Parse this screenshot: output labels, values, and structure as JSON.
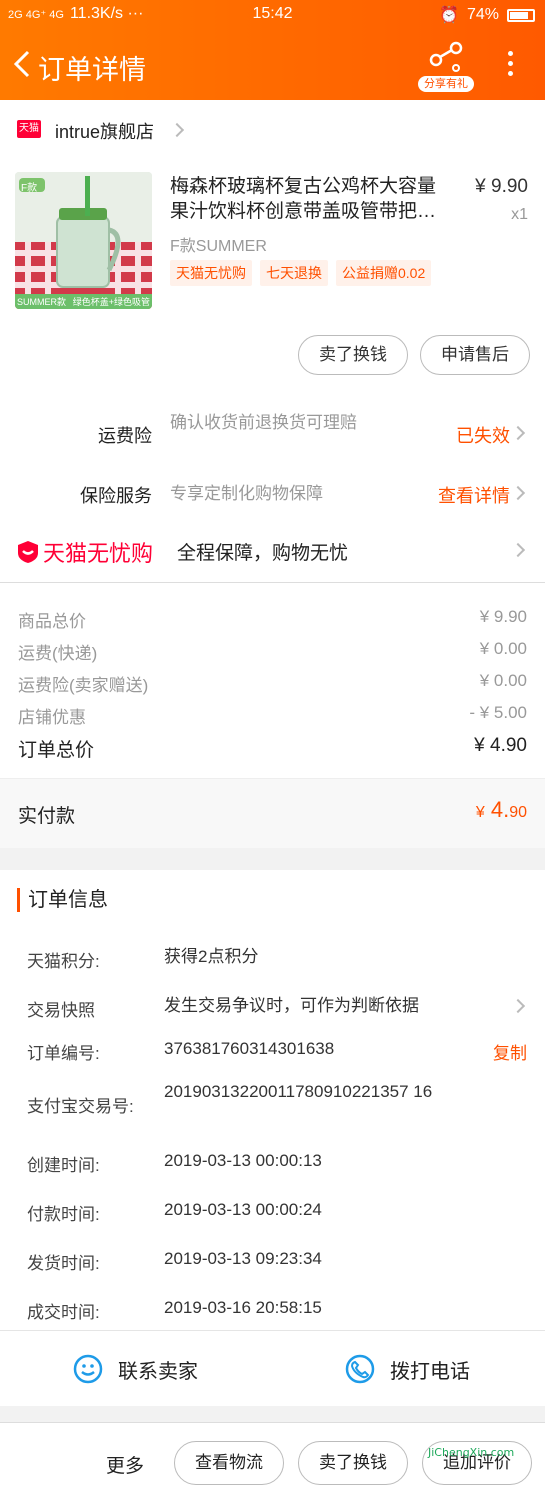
{
  "status": {
    "signal": "2G 4G⁺ 4G",
    "speed": "11.3K/s ···",
    "time": "15:42",
    "battery": "74%"
  },
  "header": {
    "title": "订单详情",
    "share_label": "分享有礼"
  },
  "shop": {
    "badge": "天猫",
    "name": "intrue旗舰店"
  },
  "product": {
    "title": "梅森杯玻璃杯复古公鸡杯大容量果汁饮料杯创意带盖吸管带把…",
    "price": "¥ 9.90",
    "qty": "x1",
    "sku": "F款SUMMER",
    "image_badge": "F款",
    "image_caption_left": "SUMMER款",
    "image_caption_right": "绿色杯盖+绿色吸管",
    "tags": [
      "天猫无忧购",
      "七天退换",
      "公益捐赠0.02"
    ],
    "actions": [
      "卖了换钱",
      "申请售后"
    ]
  },
  "insurance": [
    {
      "label": "运费险",
      "desc": "确认收货前退换货可理赔",
      "link": "已失效"
    },
    {
      "label": "保险服务",
      "desc": "专享定制化购物保障",
      "link": "查看详情"
    }
  ],
  "wuyou": {
    "logo": "天猫无忧购",
    "desc": "全程保障，购物无忧"
  },
  "pricing": [
    {
      "label": "商品总价",
      "value": "¥ 9.90"
    },
    {
      "label": "运费(快递)",
      "value": "¥ 0.00"
    },
    {
      "label": "运费险(卖家赠送)",
      "value": "¥ 0.00"
    },
    {
      "label": "店铺优惠",
      "value": "- ¥ 5.00"
    },
    {
      "label": "订单总价",
      "value": "¥ 4.90"
    }
  ],
  "paid": {
    "label": "实付款",
    "currency": "¥",
    "int": "4.",
    "dec": "90"
  },
  "order_info": {
    "title": "订单信息",
    "rows": [
      {
        "k": "天猫积分:",
        "v": "获得2点积分"
      },
      {
        "k": "交易快照",
        "v": "发生交易争议时，可作为判断依据"
      },
      {
        "k": "订单编号:",
        "v": "376381760314301638",
        "action": "复制"
      },
      {
        "k": "支付宝交易号:",
        "v": "20190313220011780910221357 16"
      },
      {
        "k": "创建时间:",
        "v": "2019-03-13 00:00:13"
      },
      {
        "k": "付款时间:",
        "v": "2019-03-13 00:00:24"
      },
      {
        "k": "发货时间:",
        "v": "2019-03-13 09:23:34"
      },
      {
        "k": "成交时间:",
        "v": "2019-03-16 20:58:15"
      }
    ]
  },
  "contact": {
    "seller": "联系卖家",
    "phone": "拨打电话"
  },
  "bottom": {
    "more": "更多",
    "logistics": "查看物流",
    "resell": "卖了换钱",
    "review": "追加评价"
  },
  "watermark": "JiChengXin.com",
  "colors": {
    "accent": "#ff5000",
    "tmall": "#ff0036",
    "header_start": "#ff7a00",
    "header_end": "#ff5a00"
  }
}
